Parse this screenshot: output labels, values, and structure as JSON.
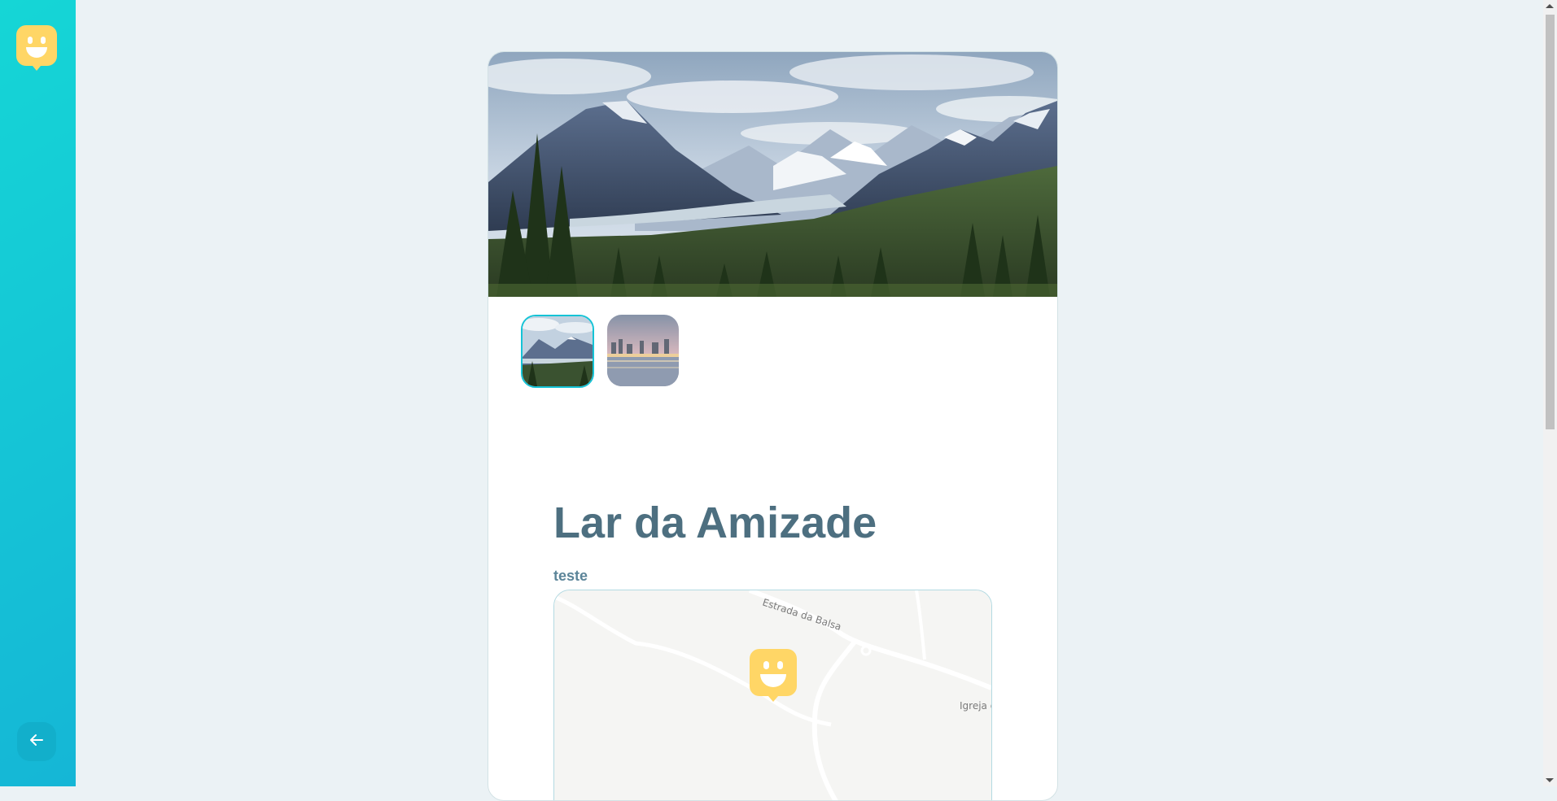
{
  "sidebar": {
    "logo_icon": "happy-face-logo-icon",
    "back_icon": "arrow-left-icon"
  },
  "orphanage": {
    "name": "Lar da Amizade",
    "about": "teste",
    "images": [
      {
        "name": "mountains-lake-image"
      },
      {
        "name": "city-night-bridge-image"
      }
    ],
    "map": {
      "street_label": "Estrada da Balsa",
      "place_label": "Igreja d",
      "marker_icon": "happy-face-marker-icon"
    }
  },
  "colors": {
    "sidebar_gradient_start": "#15B6D6",
    "sidebar_gradient_end": "#15D6D6",
    "logo_yellow": "#FFD666",
    "title": "#4D6F80",
    "text": "#5C8599",
    "background": "#EBF2F5"
  }
}
